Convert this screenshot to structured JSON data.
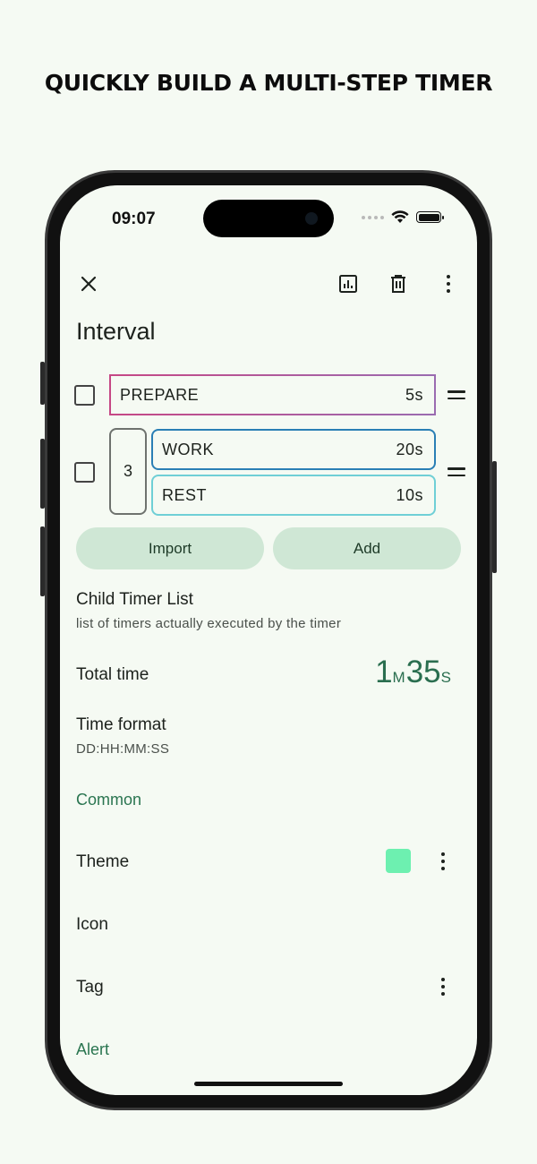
{
  "headline": {
    "before": "QUICKLY BUILD A ",
    "highlight": "MULTI-STEP",
    "after": " TIMER"
  },
  "status_bar": {
    "time": "09:07"
  },
  "toolbar": {
    "close_icon": "close-icon",
    "stats_icon": "bar-chart-icon",
    "delete_icon": "trash-icon",
    "more_icon": "more-vertical-icon"
  },
  "page_title": "Interval",
  "timers": [
    {
      "name": "PREPARE",
      "duration": "5s",
      "color": "#c64785"
    },
    {
      "name": "WORK",
      "duration": "20s",
      "color": "#2a7fb5"
    },
    {
      "name": "REST",
      "duration": "10s",
      "color": "#6fcfd6"
    }
  ],
  "repeat_group": {
    "count": "3"
  },
  "buttons": {
    "import": "Import",
    "add": "Add"
  },
  "child_timer_list": {
    "title": "Child Timer List",
    "subtitle": "list of timers actually executed by the timer"
  },
  "total_time": {
    "label": "Total time",
    "minutes": "1",
    "minutes_unit": "M",
    "seconds": "35",
    "seconds_unit": "S"
  },
  "time_format": {
    "label": "Time format",
    "value": "DD:HH:MM:SS"
  },
  "sections": {
    "common": "Common",
    "alert": "Alert"
  },
  "settings": {
    "theme": {
      "label": "Theme",
      "color": "#6df0b0"
    },
    "icon": {
      "label": "Icon"
    },
    "tag": {
      "label": "Tag"
    }
  }
}
